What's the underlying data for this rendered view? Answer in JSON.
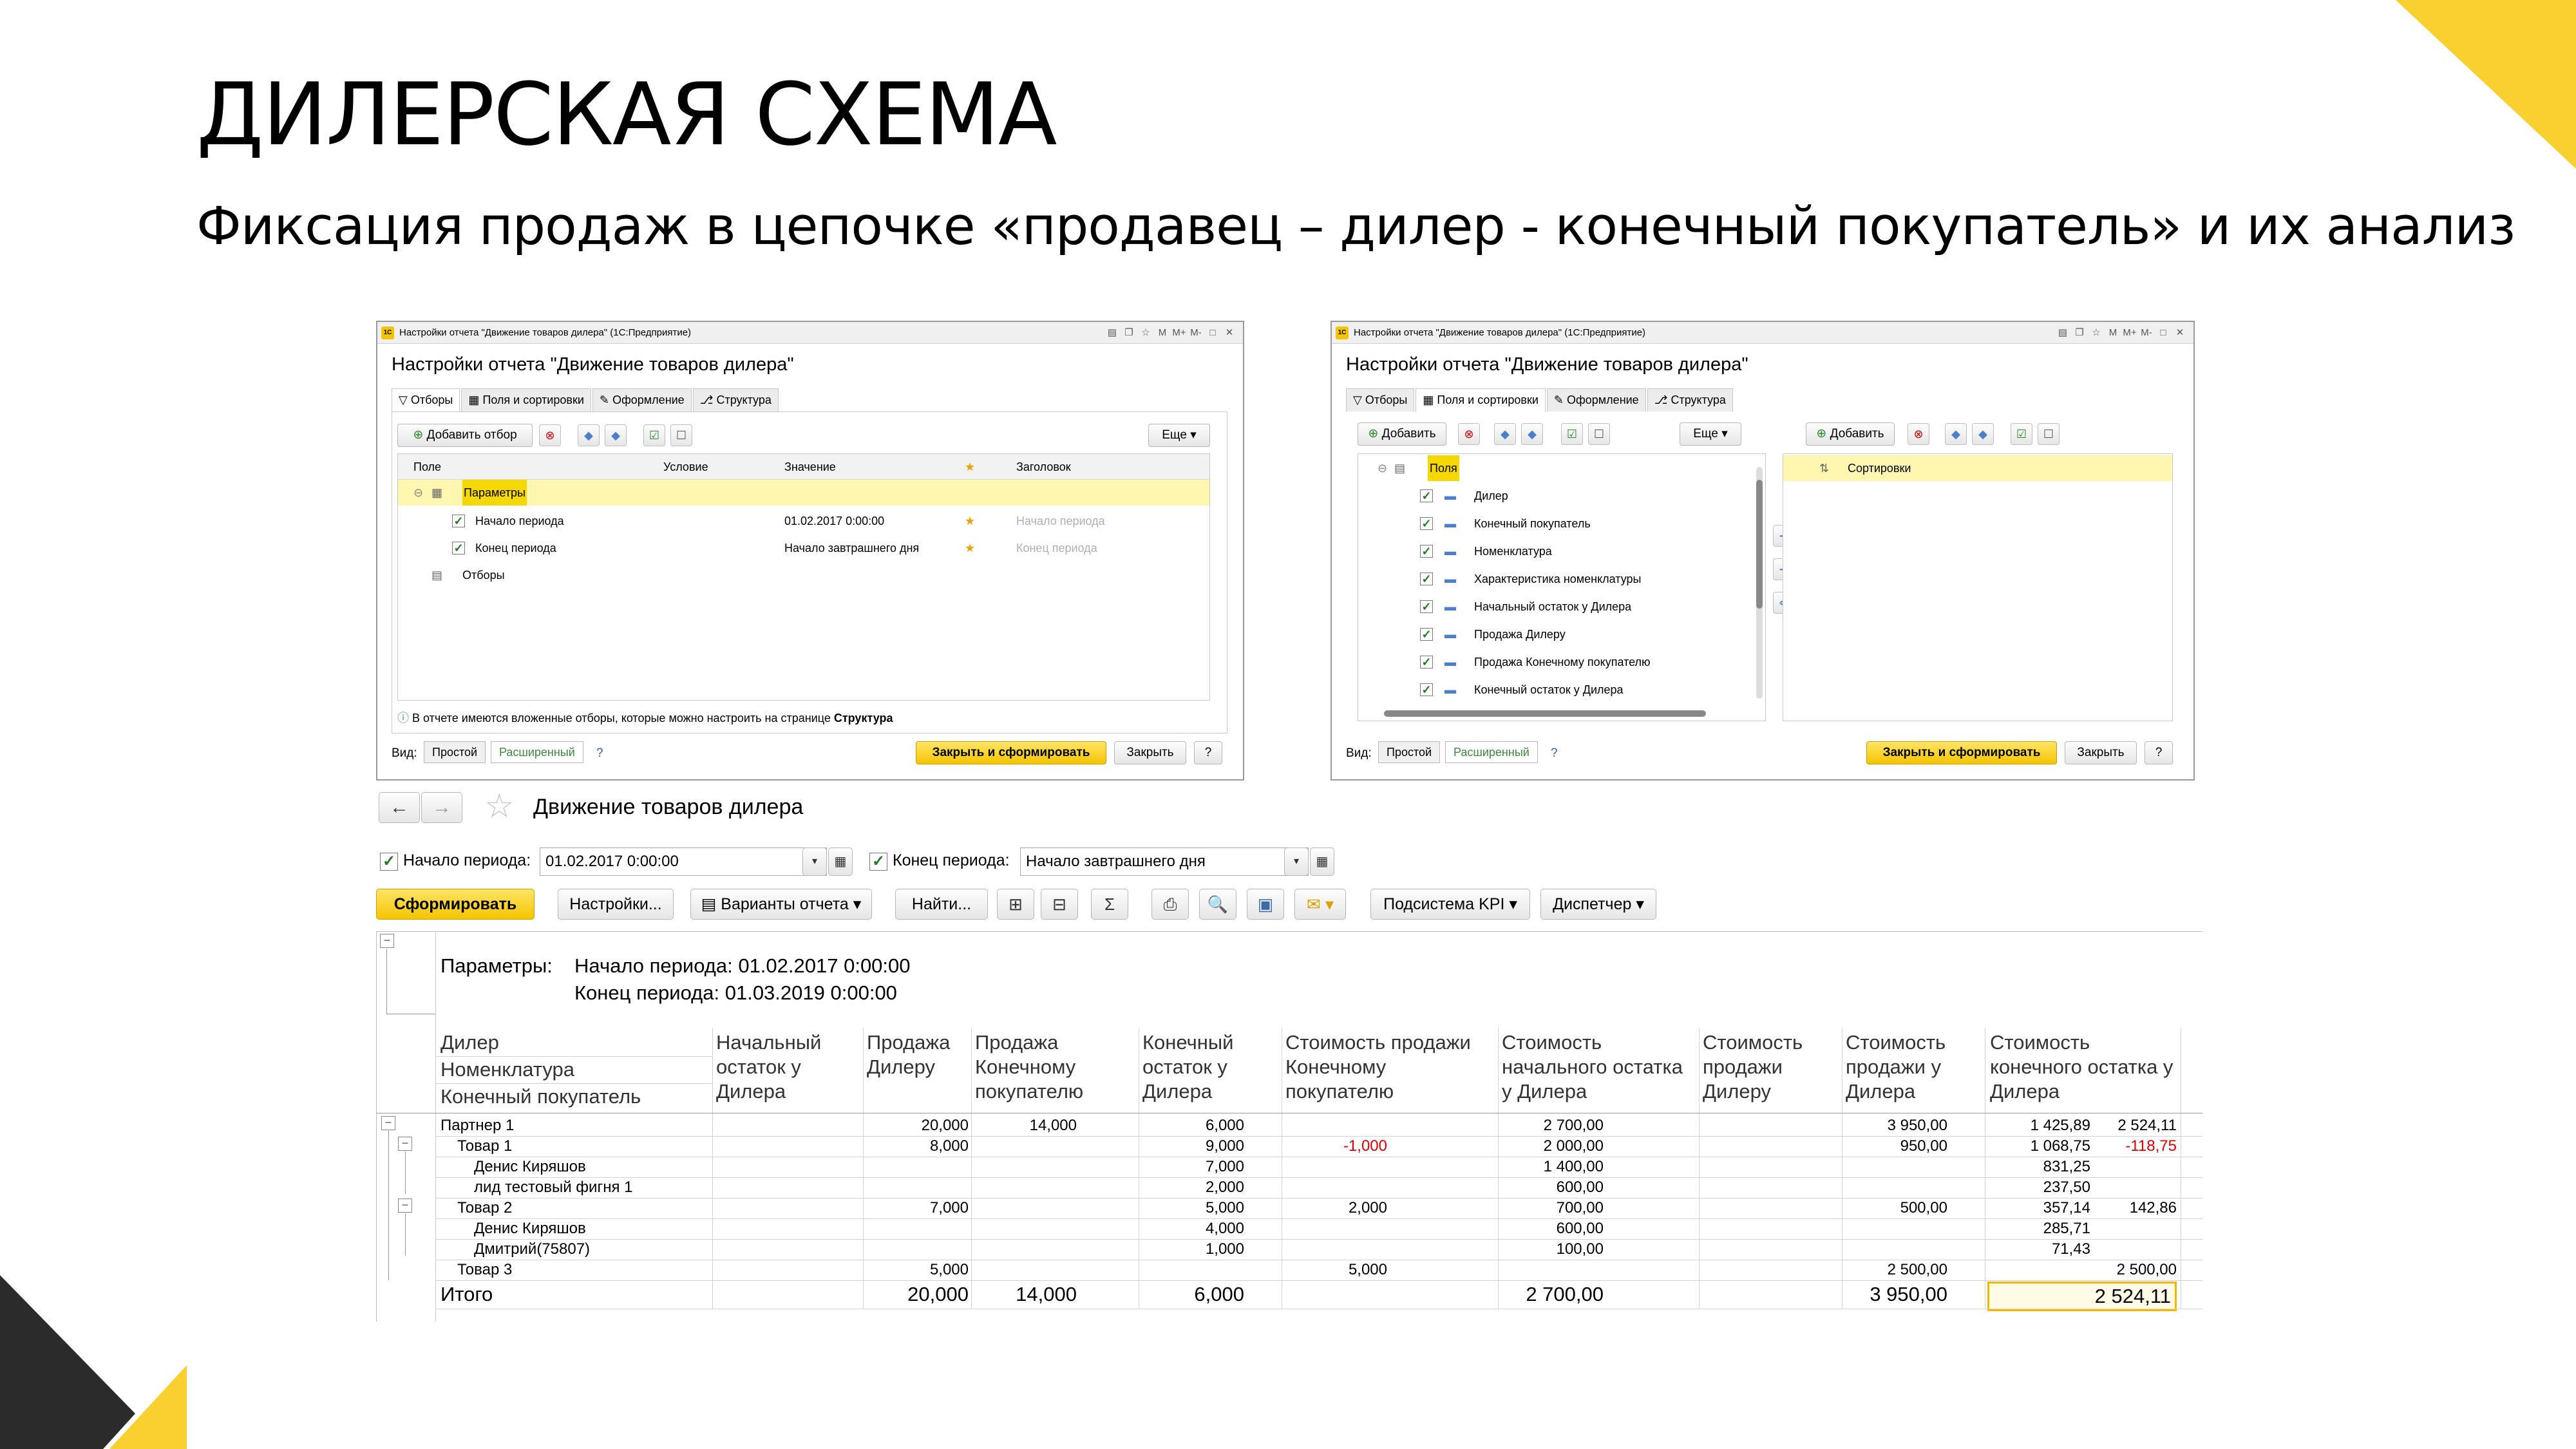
{
  "slide": {
    "title": "ДИЛЕРСКАЯ СХЕМА",
    "subtitle": "Фиксация продаж в цепочке «продавец – дилер - конечный покупатель» и их анализ"
  },
  "colors": {
    "accent": "#f9d02f",
    "dark": "#2b2b2b",
    "red": "#e00000"
  },
  "dialog1": {
    "window_title": "Настройки отчета \"Движение товаров дилера\" (1С:Предприятие)",
    "heading": "Настройки отчета \"Движение товаров дилера\"",
    "tabs": [
      "Отборы",
      "Поля и сортировки",
      "Оформление",
      "Структура"
    ],
    "add_filter": "Добавить отбор",
    "more": "Еще",
    "columns": {
      "field": "Поле",
      "condition": "Условие",
      "value": "Значение",
      "title": "Заголовок"
    },
    "rows": [
      {
        "label": "Параметры"
      },
      {
        "label": "Начало периода",
        "value": "01.02.2017 0:00:00",
        "title": "Начало периода"
      },
      {
        "label": "Конец периода",
        "value": "Начало завтрашнего дня",
        "title": "Конец периода"
      },
      {
        "label": "Отборы"
      }
    ],
    "info_prefix": "В отчете имеются вложенные отборы, которые можно настроить на странице ",
    "info_link": "Структура",
    "view_label": "Вид:",
    "view_simple": "Простой",
    "view_extended": "Расширенный",
    "help": "?",
    "close_and_run": "Закрыть и сформировать",
    "close": "Закрыть"
  },
  "dialog2": {
    "window_title": "Настройки отчета \"Движение товаров дилера\" (1С:Предприятие)",
    "heading": "Настройки отчета \"Движение товаров дилера\"",
    "tabs": [
      "Отборы",
      "Поля и сортировки",
      "Оформление",
      "Структура"
    ],
    "add": "Добавить",
    "more": "Еще",
    "fields_root": "Поля",
    "fields": [
      "Дилер",
      "Конечный покупатель",
      "Номенклатура",
      "Характеристика номенклатуры",
      "Начальный остаток у Дилера",
      "Продажа Дилеру",
      "Продажа Конечному покупателю",
      "Конечный остаток у Дилера"
    ],
    "add_sort": "Добавить",
    "sort_root": "Сортировки",
    "view_label": "Вид:",
    "view_simple": "Простой",
    "view_extended": "Расширенный",
    "help": "?",
    "close_and_run": "Закрыть и сформировать",
    "close": "Закрыть"
  },
  "form": {
    "title": "Движение товаров дилера",
    "start_label": "Начало периода:",
    "start_value": "01.02.2017  0:00:00",
    "end_label": "Конец периода:",
    "end_value": "Начало завтрашнего дня",
    "btn_run": "Сформировать",
    "btn_settings": "Настройки...",
    "btn_variants": "Варианты отчета",
    "btn_find": "Найти...",
    "btn_kpi": "Подсистема KPI",
    "btn_dispatcher": "Диспетчер"
  },
  "report": {
    "params_label": "Параметры:",
    "param1": "Начало периода: 01.02.2017 0:00:00",
    "param2": "Конец периода: 01.03.2019 0:00:00",
    "group_headers": [
      "Дилер",
      "Номенклатура",
      "Конечный покупатель"
    ],
    "headers": [
      "Начальный остаток у Дилера",
      "Продажа Дилеру",
      "Продажа Конечному покупателю",
      "Конечный остаток у Дилера",
      "Стоимость продажи Конечному покупателю",
      "Стоимость начального остатка у Дилера",
      "Стоимость продажи Дилеру",
      "Стоимость продажи у Дилера",
      "Стоимость конечного остатка у Дилера"
    ],
    "rows": [
      {
        "name": "Партнер 1",
        "level": 0,
        "cells": [
          "20,000",
          "14,000",
          "6,000",
          "",
          "2 700,00",
          "",
          "3 950,00",
          "1 425,89",
          "2 524,11"
        ]
      },
      {
        "name": "Товар 1",
        "level": 1,
        "cells": [
          "8,000",
          "",
          "9,000",
          "-1,000",
          "2 000,00",
          "",
          "950,00",
          "1 068,75",
          "-118,75"
        ]
      },
      {
        "name": "Денис Киряшов",
        "level": 2,
        "cells": [
          "",
          "",
          "7,000",
          "",
          "1 400,00",
          "",
          "",
          "831,25",
          ""
        ]
      },
      {
        "name": "лид тестовый фигня 1",
        "level": 2,
        "cells": [
          "",
          "",
          "2,000",
          "",
          "600,00",
          "",
          "",
          "237,50",
          ""
        ]
      },
      {
        "name": "Товар 2",
        "level": 1,
        "cells": [
          "7,000",
          "",
          "5,000",
          "2,000",
          "700,00",
          "",
          "500,00",
          "357,14",
          "142,86"
        ]
      },
      {
        "name": "Денис Киряшов",
        "level": 2,
        "cells": [
          "",
          "",
          "4,000",
          "",
          "600,00",
          "",
          "",
          "285,71",
          ""
        ]
      },
      {
        "name": "Дмитрий(75807)",
        "level": 2,
        "cells": [
          "",
          "",
          "1,000",
          "",
          "100,00",
          "",
          "",
          "71,43",
          ""
        ]
      },
      {
        "name": "Товар 3",
        "level": 1,
        "cells": [
          "5,000",
          "",
          "",
          "5,000",
          "",
          "",
          "2 500,00",
          "",
          "2 500,00"
        ]
      }
    ],
    "total": {
      "name": "Итого",
      "cells": [
        "20,000",
        "14,000",
        "6,000",
        "",
        "2 700,00",
        "",
        "3 950,00",
        "1 425,89",
        "2 524,11"
      ]
    }
  }
}
